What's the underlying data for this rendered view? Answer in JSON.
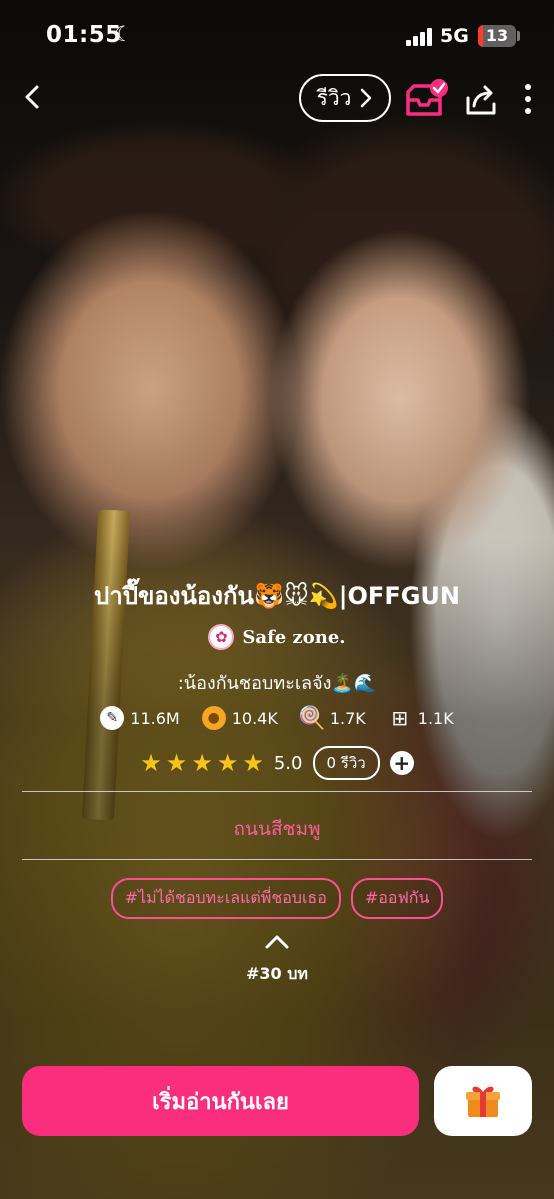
{
  "status_bar": {
    "time": "01:55",
    "network": "5G",
    "battery": "13",
    "battery_level": 0.13
  },
  "nav": {
    "review_label": "รีวิว"
  },
  "story": {
    "title": "ปาปี๊ของน้องกัน🐯🐭💫|OFFGUN",
    "author": "Safe zone.",
    "tagline": ":น้องกันชอบทะเลจัง🏝️🌊",
    "stats": {
      "reads": "11.6M",
      "coins": "10.4K",
      "candies": "1.7K",
      "library_adds": "1.1K"
    },
    "rating": {
      "stars": 5,
      "value": "5.0",
      "review_count": "0 รีวิว"
    },
    "category": "ถนนสีชมพู",
    "tags": [
      "#ไม่ได้ชอบทะเลแต่พี่ชอบเธอ",
      "#ออฟกัน"
    ],
    "chapter_count": "#30 บท"
  },
  "actions": {
    "read_label": "เริ่มอ่านกันเลย"
  },
  "colors": {
    "accent": "#fa2e7c",
    "star": "#f7c41a",
    "tag_pink": "#ff4f93"
  }
}
